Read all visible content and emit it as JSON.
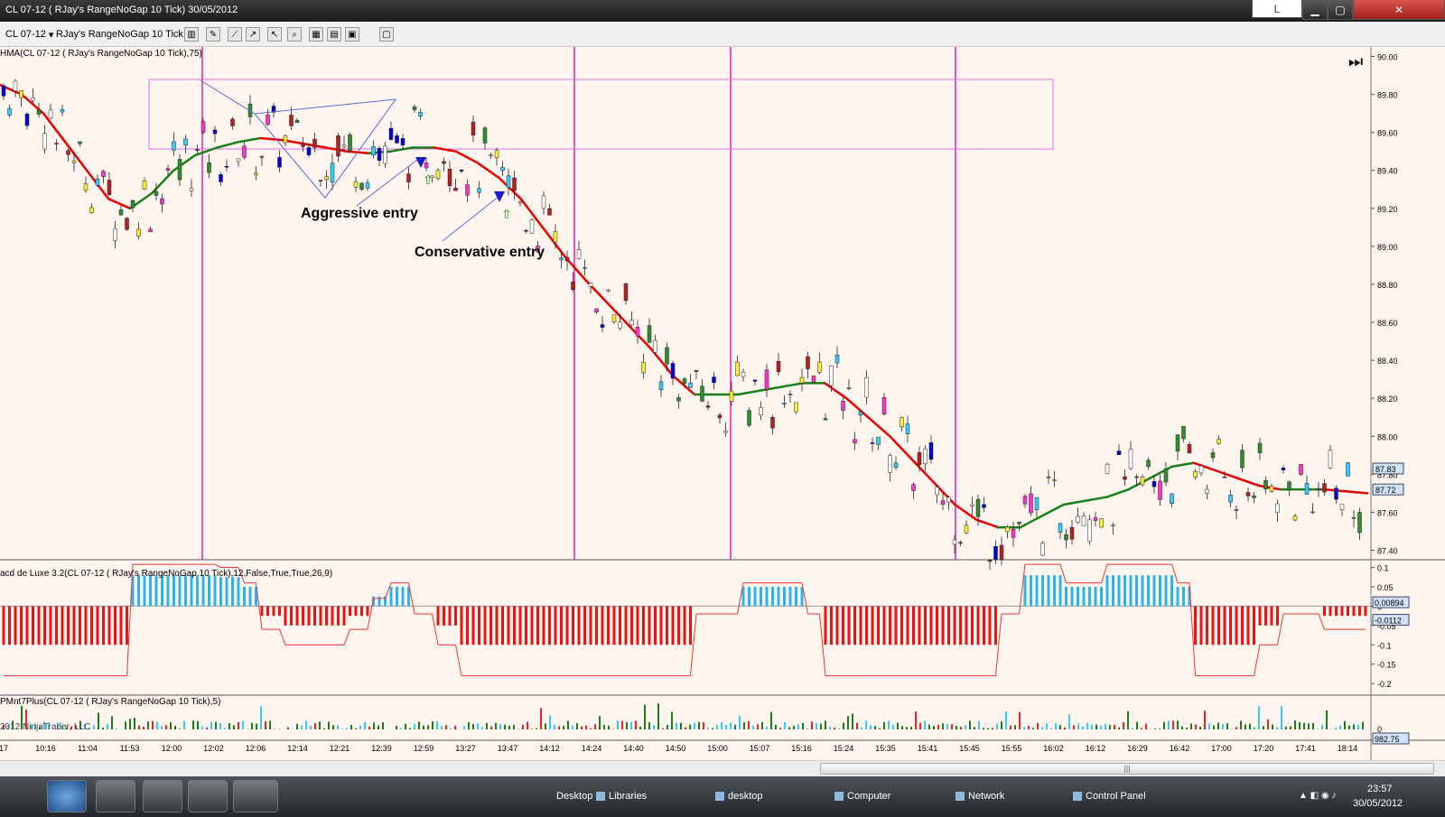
{
  "window": {
    "title": "CL 07-12 ( RJay's RangeNoGap  10 Tick)  30/05/2012",
    "button_l": "L",
    "min_icon": "minimize-icon",
    "max_icon": "maximize-icon",
    "close_icon": "close-icon"
  },
  "toolbar": {
    "instrument": "CL 07-12",
    "period": "RJay's RangeNoGap  10 Tick",
    "icons": [
      "bar-type-icon",
      "pencil-icon",
      "draw-icon",
      "cursor-icon",
      "pointer-icon",
      "zoom-icon",
      "chart-trader-icon",
      "data-box-icon",
      "properties-icon",
      "template-icon"
    ]
  },
  "chart_data": [
    {
      "type": "candlestick",
      "indicator_label": "HMA(CL 07-12 ( RJay's RangeNoGap  10 Tick),75)",
      "yticks": [
        "90.00",
        "89.80",
        "89.60",
        "89.40",
        "89.20",
        "89.00",
        "88.80",
        "88.60",
        "88.40",
        "88.20",
        "88.00",
        "87.80",
        "87.60",
        "87.40"
      ],
      "ylim": [
        87.35,
        90.05
      ],
      "price_labels": {
        "last": "87.83",
        "hma": "87.72"
      },
      "annotations": [
        "Aggressive entry",
        "Conservative entry"
      ],
      "hma_series": [
        [
          89.85,
          89.8,
          89.7,
          89.55,
          89.4,
          89.25,
          89.2,
          89.28,
          89.4,
          89.48,
          89.52,
          89.55,
          89.57,
          89.56,
          89.54,
          89.52,
          89.5,
          89.49,
          89.5,
          89.52,
          89.52,
          89.5,
          89.44,
          89.36,
          89.25,
          89.1,
          88.95,
          88.82,
          88.7,
          88.58,
          88.46,
          88.32,
          88.22,
          88.22,
          88.22,
          88.24,
          88.26,
          88.28,
          88.28,
          88.2,
          88.1,
          88.0,
          87.88,
          87.76,
          87.64,
          87.56,
          87.52,
          87.52,
          87.58,
          87.64,
          87.66,
          87.68,
          87.72,
          87.78,
          87.84,
          87.86,
          87.82,
          87.78,
          87.74,
          87.72,
          87.72,
          87.72,
          87.71,
          87.7
        ]
      ]
    },
    {
      "type": "line",
      "indicator_label": "acd de Luxe 3.2(CL 07-12 ( RJay's RangeNoGap  10 Tick),12,False,True,True,26,9)",
      "yticks": [
        "0.1",
        "0.05",
        "0",
        "-0.05",
        "-0.1",
        "-0.15",
        "-0.2"
      ],
      "ylim": [
        -0.23,
        0.12
      ],
      "price_labels": {
        "a": "0.00894",
        "b": "-0.0112"
      }
    },
    {
      "type": "bar",
      "indicator_label": "PMnt7Plus(CL 07-12 ( RJay's RangeNoGap  10 Tick),5)",
      "copyright": "2012 NinjaTrader, LLC",
      "yticks": [
        "0"
      ],
      "price_labels": {
        "a": "982.75"
      }
    }
  ],
  "xticks": [
    "17",
    "10:16",
    "11:04",
    "11:53",
    "12:00",
    "12:02",
    "12:06",
    "12:14",
    "12:21",
    "12:39",
    "12:59",
    "13:27",
    "13:47",
    "14:12",
    "14:24",
    "14:40",
    "14:50",
    "15:00",
    "15:07",
    "15:16",
    "15:24",
    "15:35",
    "15:41",
    "15:45",
    "15:55",
    "16:02",
    "16:12",
    "16:29",
    "16:42",
    "17:00",
    "17:20",
    "17:41",
    "18:14"
  ],
  "taskbar": {
    "desktop": "Desktop",
    "libraries": "Libraries",
    "desktop2": "desktop",
    "computer": "Computer",
    "network": "Network",
    "control_panel": "Control Panel",
    "time": "23:57",
    "date": "30/05/2012"
  },
  "colors": {
    "bg": "#fff5ef",
    "hma_down": "#e60000",
    "hma_up": "#1a7f1a",
    "vline": "#e020b0",
    "box": "#e070e0",
    "hist_pos": "#2bb5f0",
    "hist_neg": "#ee1111"
  }
}
